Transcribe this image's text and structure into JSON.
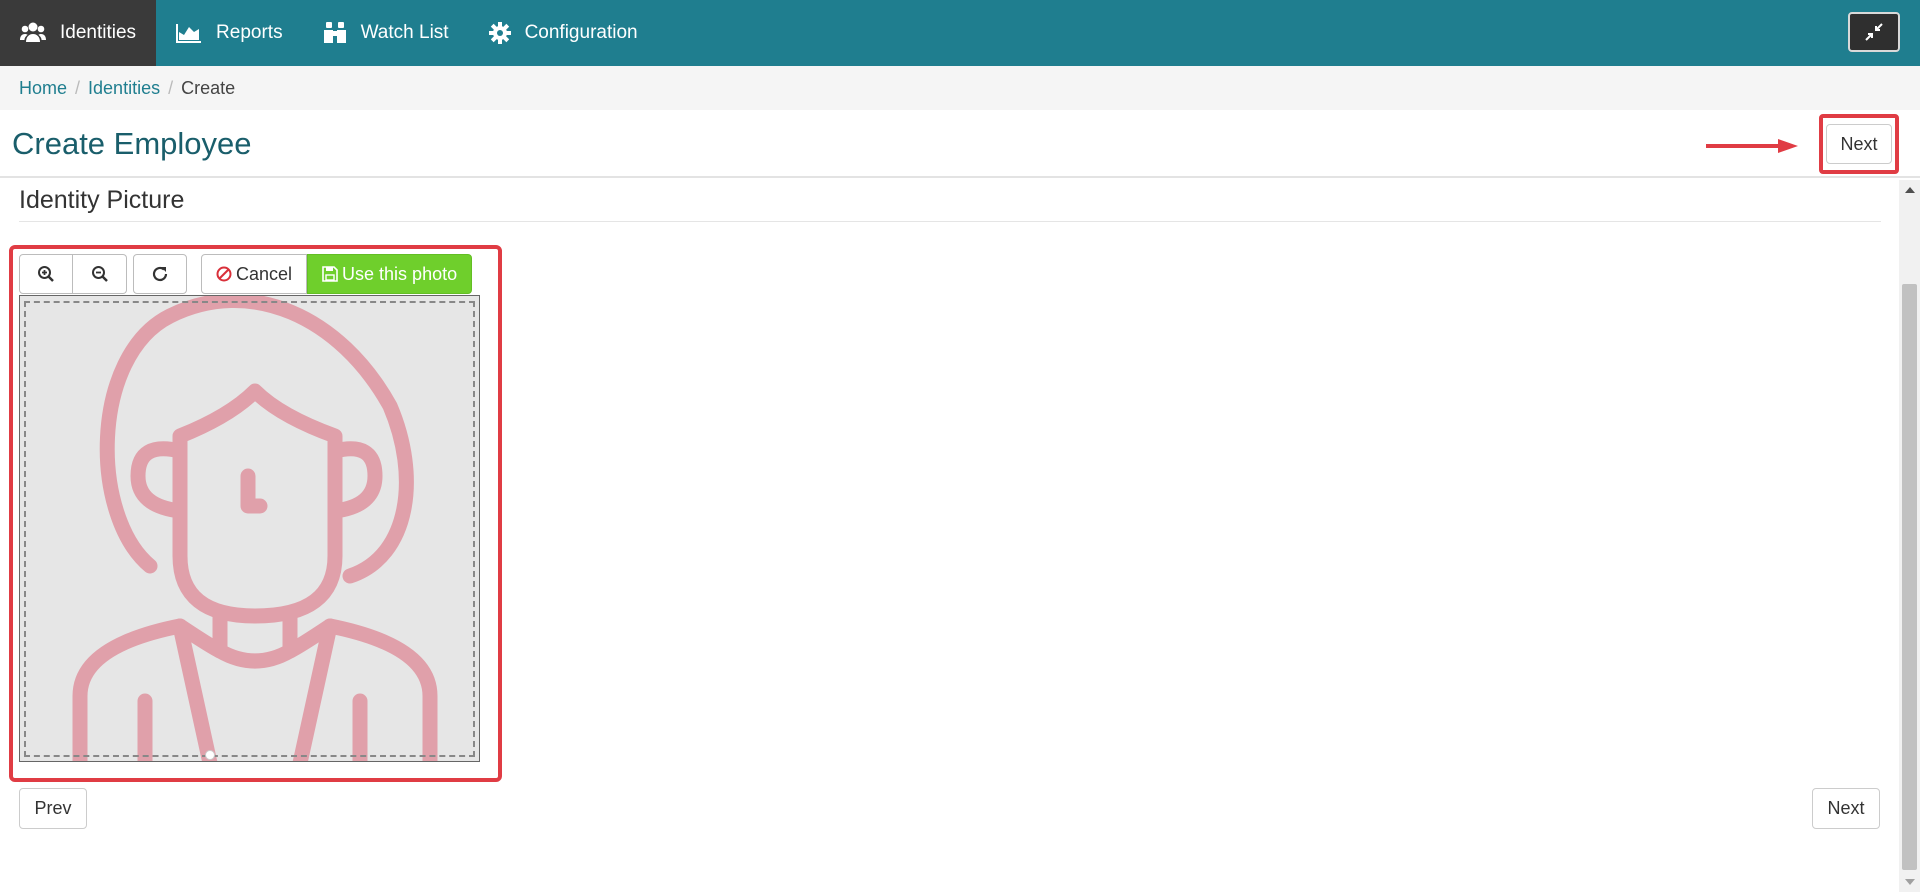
{
  "nav": {
    "items": [
      {
        "label": "Identities",
        "icon": "users-icon",
        "active": true
      },
      {
        "label": "Reports",
        "icon": "area-chart-icon",
        "active": false
      },
      {
        "label": "Watch List",
        "icon": "binoculars-icon",
        "active": false
      },
      {
        "label": "Configuration",
        "icon": "gear-icon",
        "active": false
      }
    ],
    "collapse_icon": "compress-icon"
  },
  "breadcrumb": {
    "home": "Home",
    "identities": "Identities",
    "current": "Create"
  },
  "header": {
    "title": "Create Employee",
    "next_label": "Next"
  },
  "section": {
    "title": "Identity Picture"
  },
  "cropper": {
    "zoom_in_icon": "zoom-in-icon",
    "zoom_out_icon": "zoom-out-icon",
    "rotate_icon": "rotate-icon",
    "cancel_label": "Cancel",
    "use_label": "Use this photo"
  },
  "footer": {
    "prev_label": "Prev",
    "next_label": "Next"
  },
  "colors": {
    "nav_bg": "#1f7e8f",
    "nav_active": "#3a3a3a",
    "accent_green": "#6fcf2c",
    "highlight_red": "#e03c44",
    "title_color": "#1a5e6b",
    "avatar_stroke": "#e0a0aa"
  }
}
